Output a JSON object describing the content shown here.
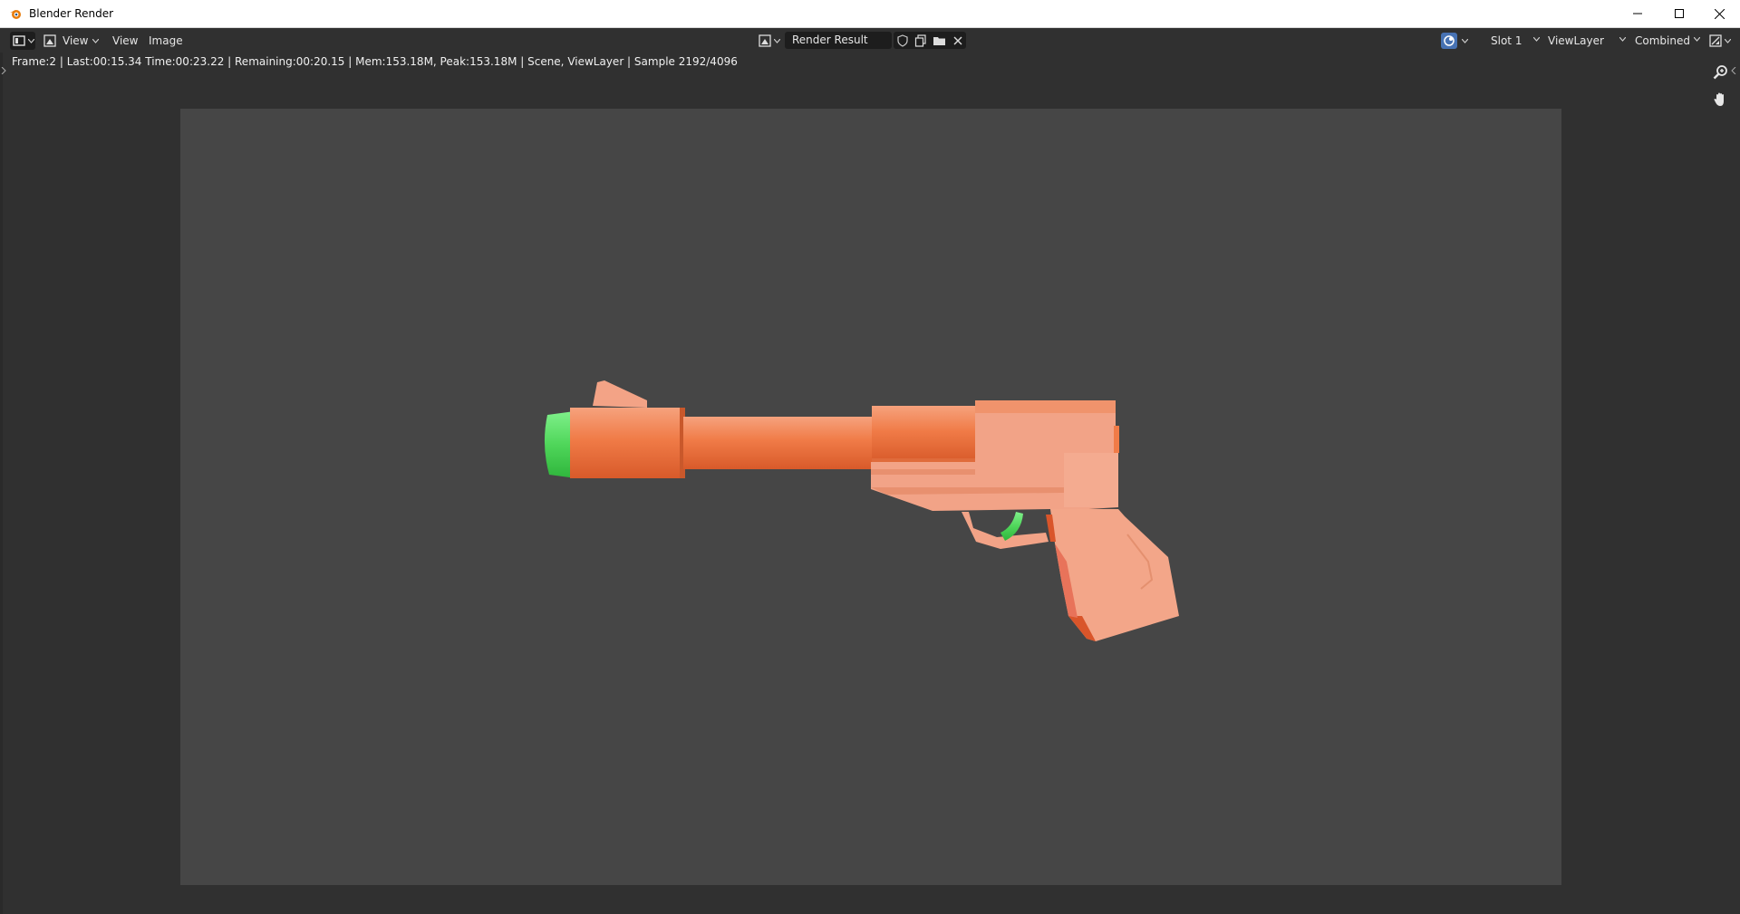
{
  "window": {
    "title": "Blender Render",
    "controls": [
      "minimize-icon",
      "maximize-icon",
      "close-icon"
    ]
  },
  "header": {
    "editor_type_icon": "image-editor-icon",
    "view_mode_icon": "image-view-icon",
    "view_dropdown_label": "View",
    "menu": [
      "View",
      "Image"
    ],
    "image_browse_icon": "image-browse-icon",
    "image_name": "Render Result",
    "image_actions": [
      "fake-user-shield-icon",
      "duplicate-icon",
      "open-folder-icon",
      "unlink-x-icon"
    ],
    "overlay_icon": "display-channels-icon",
    "slot": "Slot 1",
    "view_layer": "ViewLayer",
    "pass": "Combined",
    "gizmo_icon": "sample-tool-icon"
  },
  "status": {
    "text": "Frame:2 | Last:00:15.34 Time:00:23.22 | Remaining:00:20.15 | Mem:153.18M, Peak:153.18M | Scene, ViewLayer | Sample 2192/4096"
  },
  "viewport_tools": [
    "zoom-icon",
    "pan-hand-icon"
  ],
  "render": {
    "subject": "low-poly toy pistol",
    "colors": {
      "background": "#464646",
      "body": "#f2a387",
      "barrel": "#f07a48",
      "accent_green": "#4fd65a"
    }
  }
}
